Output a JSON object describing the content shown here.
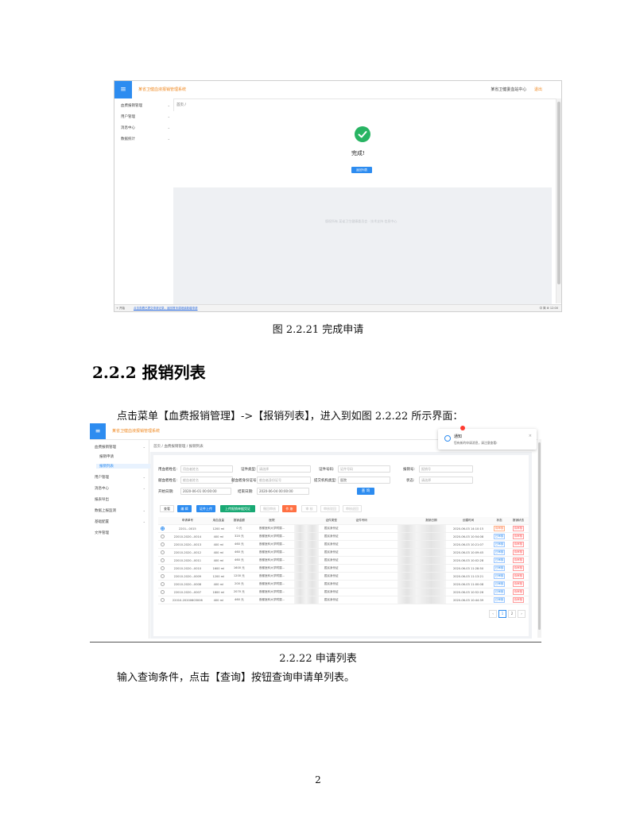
{
  "fig1": {
    "menu_icon": "≡",
    "system_title": "某省卫健血液报销管理系统",
    "topbar_right": [
      "某省卫健委血站中心",
      "退出"
    ],
    "sidebar": [
      {
        "label": "血费报销管理",
        "arrow": "⌄"
      },
      {
        "label": "用户管理",
        "arrow": "⌄"
      },
      {
        "label": "消息中心",
        "arrow": "⌄"
      },
      {
        "label": "数据统计",
        "arrow": "⌄"
      }
    ],
    "breadcrumb": "首页 /",
    "status_text": "完成!",
    "action_button": "返回列表",
    "grey_note": "版权所有 某省卫生健康委员会 · 技术支持 信息中心",
    "taskbar_left": "+ 开始",
    "taskbar_middle": "点击查看已提交申请记录，返回首页或继续新增申请",
    "taskbar_right": "中 简 ⚙ 12:00"
  },
  "caption1": "图 2.2.21  完成申请",
  "heading": "2.2.2  报销列表",
  "para1": "点击菜单【血费报销管理】->【报销列表】，进入到如图 2.2.22 所示界面：",
  "fig2": {
    "menu_icon": "≡",
    "system_title": "某省卫健血液报销管理系统",
    "sidebar": [
      {
        "label": "血费报销管理",
        "arrow": "⌄",
        "active": false
      },
      {
        "label": "报销申请",
        "arrow": "",
        "active": false
      },
      {
        "label": "报销列表",
        "arrow": "",
        "active": true
      },
      {
        "label": "用户管理",
        "arrow": "⌄",
        "active": false
      },
      {
        "label": "消息中心",
        "arrow": "⌄",
        "active": false
      },
      {
        "label": "报表导出",
        "arrow": "",
        "active": false
      },
      {
        "label": "数据上报监测",
        "arrow": "⌄",
        "active": false
      },
      {
        "label": "基础配置",
        "arrow": "⌄",
        "active": false
      },
      {
        "label": "文件管理",
        "arrow": "",
        "active": false
      }
    ],
    "breadcrumb": "首页 / 血费报销管理 / 报销列表",
    "filters": {
      "applicant_label": "用血者姓名:",
      "applicant_placeholder": "用血者姓名",
      "idtype_label": "证件类型:",
      "idtype_placeholder": "请选择",
      "idno_label": "证件号码:",
      "idno_placeholder": "证件号码",
      "claimno_label": "报销号:",
      "claimno_placeholder": "报销号",
      "donor_label": "献血者姓名:",
      "donor_placeholder": "献血者姓名",
      "donorid_label": "献血者身份证号:",
      "donorid_placeholder": "献血者身份证号",
      "org_label": "提交机构类型:",
      "org_value": "医院",
      "status_label": "状态:",
      "status_placeholder": "请选择",
      "start_label": "开始日期:",
      "start_value": "2020-06-01 00:00:00",
      "end_label": "结束日期:",
      "end_value": "2020-06-04 00:00:00",
      "query_button": "查 询"
    },
    "toolbar": [
      {
        "label": "查看",
        "style": "white"
      },
      {
        "label": "编 辑",
        "style": "blue"
      },
      {
        "label": "证件上传",
        "style": "blue"
      },
      {
        "label": "上传报销单据凭证",
        "style": "green"
      },
      {
        "label": "撤回审核",
        "style": "off"
      },
      {
        "label": "作 废",
        "style": "orange"
      },
      {
        "label": "审 核",
        "style": "off"
      },
      {
        "label": "审核驳回",
        "style": "off"
      },
      {
        "label": "审核退回",
        "style": "off"
      }
    ],
    "table": {
      "headers": [
        "",
        "申请单号",
        "用血血量",
        "报销金额",
        "医院",
        "",
        "",
        "证件类型",
        "证件号码",
        "",
        "",
        "报销日期",
        "创建时间",
        "状态",
        "报销状态"
      ],
      "rows": [
        {
          "selected": true,
          "cells": [
            "2201...0015",
            "1200 ml",
            "0 元",
            "首都医科大学附属...",
            "",
            "",
            "居民身份证",
            "",
            "",
            "",
            "2020-06-03",
            "2020-06-03 14:10:15",
            "待审核",
            "待审核"
          ]
        },
        {
          "selected": false,
          "cells": [
            "22010-2020...0014",
            "400 ml",
            "320 元",
            "首都医科大学附属...",
            "",
            "",
            "居民身份证",
            "",
            "",
            "",
            "2020-06-03",
            "2020-06-03 10:54:08",
            "已审核",
            "待审核"
          ]
        },
        {
          "selected": false,
          "cells": [
            "22010-2020...0013",
            "400 ml",
            "460 元",
            "首都医科大学附属...",
            "",
            "",
            "居民身份证",
            "",
            "",
            "",
            "2020-06-03",
            "2020-06-03 10:21:07",
            "已审核",
            "待审核"
          ]
        },
        {
          "selected": false,
          "cells": [
            "22010-2020...0012",
            "400 ml",
            "460 元",
            "首都医科大学附属...",
            "",
            "",
            "居民身份证",
            "",
            "",
            "",
            "2020-06-03",
            "2020-06-03 10:09:45",
            "已审核",
            "待审核"
          ]
        },
        {
          "selected": false,
          "cells": [
            "22010-2020...0011",
            "400 ml",
            "460 元",
            "首都医科大学附属...",
            "",
            "",
            "居民身份证",
            "",
            "",
            "",
            "2020-06-03",
            "2020-06-03 10:02:28",
            "已审核",
            "待审核"
          ]
        },
        {
          "selected": false,
          "cells": [
            "22010-2020...0010",
            "1600 ml",
            "1600 元",
            "首都医科大学附属...",
            "",
            "",
            "居民身份证",
            "",
            "",
            "",
            "2020-06-03",
            "2020-06-03 11:28:50",
            "已审核",
            "待审核"
          ]
        },
        {
          "selected": false,
          "cells": [
            "22010-2020...0009",
            "1200 ml",
            "1200 元",
            "首都医科大学附属...",
            "",
            "",
            "居民身份证",
            "",
            "",
            "",
            "2020-06-03",
            "2020-06-03 11:13:21",
            "已审核",
            "待审核"
          ]
        },
        {
          "selected": false,
          "cells": [
            "22010-2020...0008",
            "400 ml",
            "200 元",
            "首都医科大学附属...",
            "",
            "",
            "居民身份证",
            "",
            "",
            "",
            "2020-06-03",
            "2020-06-03 11:00:08",
            "已审核",
            "待审核"
          ]
        },
        {
          "selected": false,
          "cells": [
            "22010-2020...0007",
            "1800 ml",
            "2070 元",
            "首都医科大学附属...",
            "",
            "",
            "居民身份证",
            "",
            "",
            "",
            "2020-06-03",
            "2020-06-03 10:52:26",
            "已审核",
            "待审核"
          ]
        },
        {
          "selected": false,
          "cells": [
            "22010-20200603006",
            "400 ml",
            "460 元",
            "首都医科大学附属...",
            "",
            "",
            "居民身份证",
            "",
            "",
            "",
            "2020-06-03",
            "2020-06-03 10:44:39",
            "已审核",
            "待审核"
          ]
        }
      ]
    },
    "pager": [
      "‹",
      "1",
      "2",
      "›"
    ],
    "notification": {
      "title": "通知",
      "message": "您有新的申请消息，请注意查看!",
      "close": "×"
    }
  },
  "caption2": "2.2.22  申请列表",
  "para2": "输入查询条件，点击【查询】按钮查询申请单列表。",
  "page_number": "2",
  "colors": {
    "primary": "#2d8cf0",
    "success": "#28b463",
    "accent": "#f08a24",
    "danger": "#ff4d4f"
  }
}
